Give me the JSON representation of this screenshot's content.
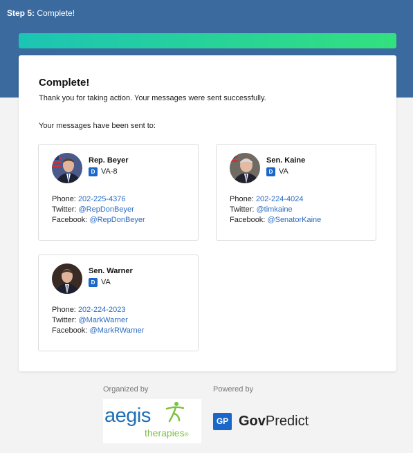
{
  "header": {
    "step_label": "Step 5:",
    "step_text": "Complete!"
  },
  "progress": {
    "fraction": 1.0
  },
  "main": {
    "title": "Complete!",
    "message": "Thank you for taking action. Your messages were sent successfully.",
    "sent_to": "Your messages have been sent to:"
  },
  "reps": [
    {
      "name": "Rep. Beyer",
      "party": "D",
      "district": "VA-8",
      "phone_label": "Phone:",
      "phone": "202-225-4376",
      "twitter_label": "Twitter:",
      "twitter": "@RepDonBeyer",
      "facebook_label": "Facebook:",
      "facebook": "@RepDonBeyer"
    },
    {
      "name": "Sen. Kaine",
      "party": "D",
      "district": "VA",
      "phone_label": "Phone:",
      "phone": "202-224-4024",
      "twitter_label": "Twitter:",
      "twitter": "@timkaine",
      "facebook_label": "Facebook:",
      "facebook": "@SenatorKaine"
    },
    {
      "name": "Sen. Warner",
      "party": "D",
      "district": "VA",
      "phone_label": "Phone:",
      "phone": "202-224-2023",
      "twitter_label": "Twitter:",
      "twitter": "@MarkWarner",
      "facebook_label": "Facebook:",
      "facebook": "@MarkRWarner"
    }
  ],
  "footer": {
    "organized_by": "Organized by",
    "powered_by": "Powered by",
    "org_logo_word": "aegis",
    "org_logo_sub": "therapies",
    "org_logo_reg": "®",
    "gp_box": "GP",
    "gp_name_bold": "Gov",
    "gp_name_rest": "Predict"
  },
  "colors": {
    "header_band": "#3a6a9e",
    "progress_start": "#1cc4b4",
    "progress_end": "#33e07f",
    "link": "#2a6cc0",
    "party_badge": "#1a66c9",
    "aegis_blue": "#1f6fb6",
    "aegis_green": "#7cc242"
  }
}
